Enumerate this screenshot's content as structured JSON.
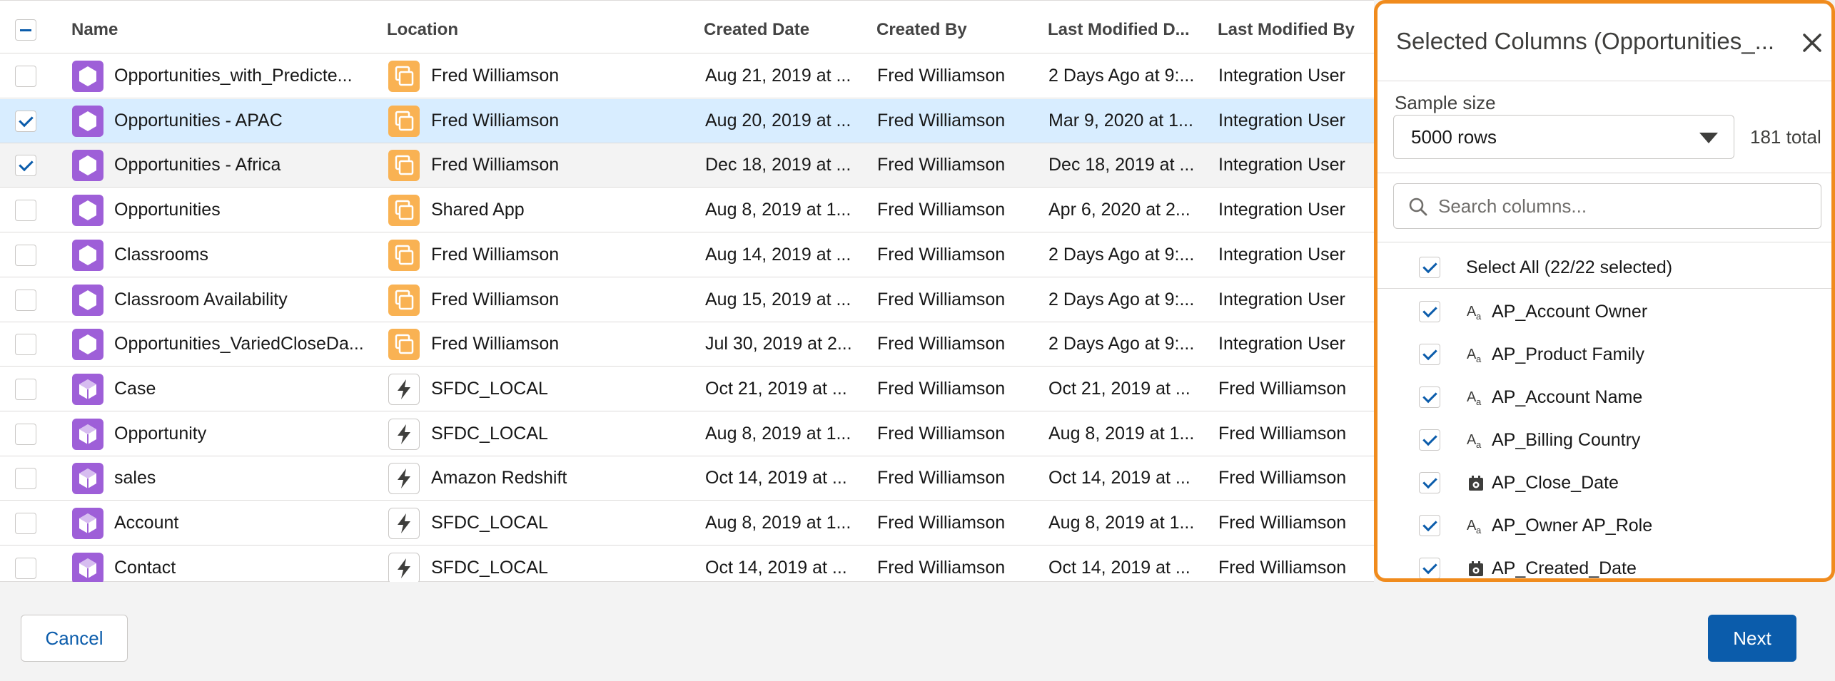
{
  "table": {
    "headers": {
      "name": "Name",
      "location": "Location",
      "created_date": "Created Date",
      "created_by": "Created By",
      "last_modified_date": "Last Modified D...",
      "last_modified_by": "Last Modified By"
    },
    "rows": [
      {
        "name": "Opportunities_with_Predicte...",
        "location": "Fred Williamson",
        "created_date": "Aug 21, 2019 at ...",
        "created_by": "Fred Williamson",
        "last_modified_date": "2 Days Ago at 9:...",
        "last_modified_by": "Integration User",
        "checked": false,
        "icon": "dataset-icon",
        "loc_icon": "app-icon"
      },
      {
        "name": "Opportunities - APAC",
        "location": "Fred Williamson",
        "created_date": "Aug 20, 2019 at ...",
        "created_by": "Fred Williamson",
        "last_modified_date": "Mar 9, 2020 at 1...",
        "last_modified_by": "Integration User",
        "checked": true,
        "icon": "dataset-icon",
        "loc_icon": "app-icon"
      },
      {
        "name": "Opportunities - Africa",
        "location": "Fred Williamson",
        "created_date": "Dec 18, 2019 at ...",
        "created_by": "Fred Williamson",
        "last_modified_date": "Dec 18, 2019 at ...",
        "last_modified_by": "Integration User",
        "checked": true,
        "icon": "dataset-icon",
        "loc_icon": "app-icon"
      },
      {
        "name": "Opportunities",
        "location": "Shared App",
        "created_date": "Aug 8, 2019 at 1...",
        "created_by": "Fred Williamson",
        "last_modified_date": "Apr 6, 2020 at 2...",
        "last_modified_by": "Integration User",
        "checked": false,
        "icon": "dataset-icon",
        "loc_icon": "app-icon"
      },
      {
        "name": "Classrooms",
        "location": "Fred Williamson",
        "created_date": "Aug 14, 2019 at ...",
        "created_by": "Fred Williamson",
        "last_modified_date": "2 Days Ago at 9:...",
        "last_modified_by": "Integration User",
        "checked": false,
        "icon": "dataset-icon",
        "loc_icon": "app-icon"
      },
      {
        "name": "Classroom Availability",
        "location": "Fred Williamson",
        "created_date": "Aug 15, 2019 at ...",
        "created_by": "Fred Williamson",
        "last_modified_date": "2 Days Ago at 9:...",
        "last_modified_by": "Integration User",
        "checked": false,
        "icon": "dataset-icon",
        "loc_icon": "app-icon"
      },
      {
        "name": "Opportunities_VariedCloseDa...",
        "location": "Fred Williamson",
        "created_date": "Jul 30, 2019 at 2...",
        "created_by": "Fred Williamson",
        "last_modified_date": "2 Days Ago at 9:...",
        "last_modified_by": "Integration User",
        "checked": false,
        "icon": "dataset-icon",
        "loc_icon": "app-icon"
      },
      {
        "name": "Case",
        "location": "SFDC_LOCAL",
        "created_date": "Oct 21, 2019 at ...",
        "created_by": "Fred Williamson",
        "last_modified_date": "Oct 21, 2019 at ...",
        "last_modified_by": "Fred Williamson",
        "checked": false,
        "icon": "object-icon",
        "loc_icon": "connection-icon"
      },
      {
        "name": "Opportunity",
        "location": "SFDC_LOCAL",
        "created_date": "Aug 8, 2019 at 1...",
        "created_by": "Fred Williamson",
        "last_modified_date": "Aug 8, 2019 at 1...",
        "last_modified_by": "Fred Williamson",
        "checked": false,
        "icon": "object-icon",
        "loc_icon": "connection-icon"
      },
      {
        "name": "sales",
        "location": "Amazon Redshift",
        "created_date": "Oct 14, 2019 at ...",
        "created_by": "Fred Williamson",
        "last_modified_date": "Oct 14, 2019 at ...",
        "last_modified_by": "Fred Williamson",
        "checked": false,
        "icon": "object-icon",
        "loc_icon": "connection-icon"
      },
      {
        "name": "Account",
        "location": "SFDC_LOCAL",
        "created_date": "Aug 8, 2019 at 1...",
        "created_by": "Fred Williamson",
        "last_modified_date": "Aug 8, 2019 at 1...",
        "last_modified_by": "Fred Williamson",
        "checked": false,
        "icon": "object-icon",
        "loc_icon": "connection-icon"
      },
      {
        "name": "Contact",
        "location": "SFDC_LOCAL",
        "created_date": "Oct 14, 2019 at ...",
        "created_by": "Fred Williamson",
        "last_modified_date": "Oct 14, 2019 at ...",
        "last_modified_by": "Fred Williamson",
        "checked": false,
        "icon": "object-icon",
        "loc_icon": "connection-icon"
      }
    ]
  },
  "panel": {
    "title": "Selected Columns (Opportunities_...",
    "close_icon": "close-icon",
    "sample_label": "Sample size",
    "sample_value": "5000 rows",
    "total": "181 total",
    "search_placeholder": "Search columns...",
    "select_all_label": "Select All (22/22 selected)",
    "columns": [
      {
        "label": "AP_Account Owner",
        "type": "text-icon"
      },
      {
        "label": "AP_Product Family",
        "type": "text-icon"
      },
      {
        "label": "AP_Account Name",
        "type": "text-icon"
      },
      {
        "label": "AP_Billing Country",
        "type": "text-icon"
      },
      {
        "label": "AP_Close_Date",
        "type": "date-icon"
      },
      {
        "label": "AP_Owner AP_Role",
        "type": "text-icon"
      },
      {
        "label": "AP_Created_Date",
        "type": "date-icon"
      }
    ]
  },
  "footer": {
    "cancel_label": "Cancel",
    "next_label": "Next"
  },
  "colors": {
    "accent": "#0b5cab",
    "selected_row": "#d8edff",
    "panel_border": "#f08b1d",
    "dataset_icon": "#9e5fd8",
    "app_icon": "#f9b253"
  }
}
